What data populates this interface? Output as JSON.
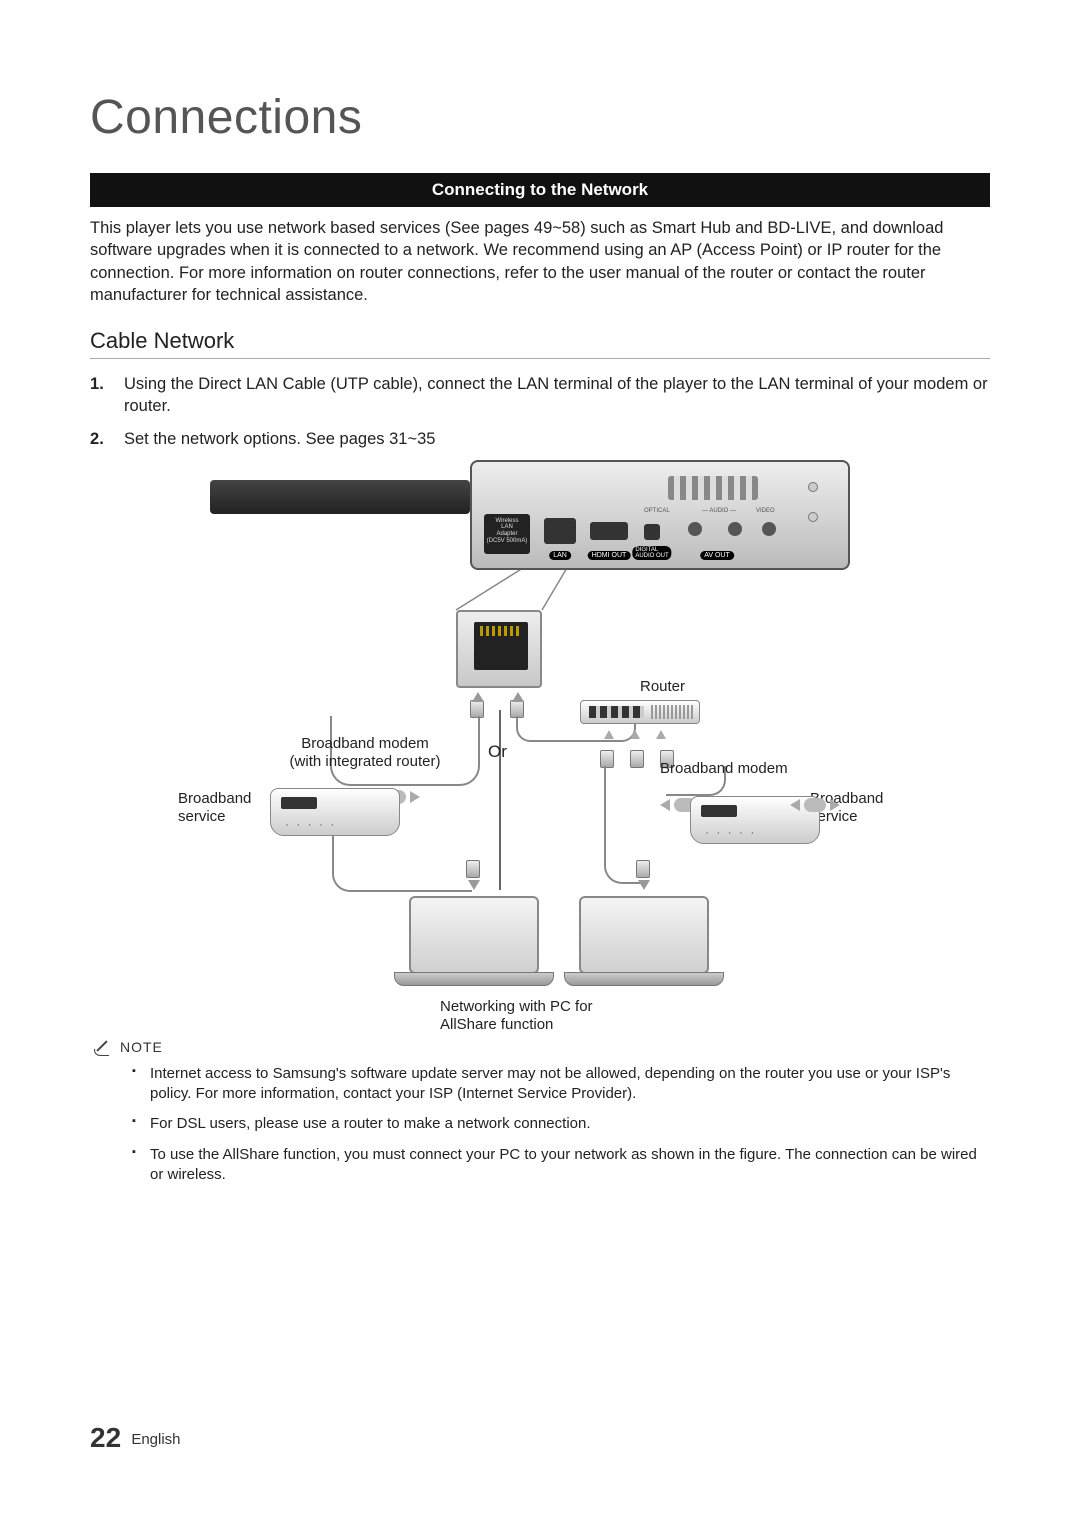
{
  "chapter_title": "Connections",
  "section_bar": "Connecting to the Network",
  "intro": "This player lets you use network based services (See pages 49~58) such as Smart Hub and BD-LIVE, and download software upgrades when it is connected to a network. We recommend using an AP (Access Point) or IP router for the connection. For more information on router connections, refer to the user manual of the router or contact the router manufacturer for technical assistance.",
  "sub_heading": "Cable Network",
  "steps": [
    "Using the Direct LAN Cable (UTP cable), connect the LAN terminal of the player to the LAN terminal of your modem or router.",
    "Set the network options. See pages 31~35"
  ],
  "diagram": {
    "ports": {
      "wlan": "Wireless\nLAN\nAdapter\n(DC5V 500mA)",
      "lan": "LAN",
      "hdmi": "HDMI OUT",
      "digital": "DIGITAL\nAUDIO OUT",
      "optical": "OPTICAL",
      "avout": "AV OUT",
      "audio": "— AUDIO —",
      "video": "VIDEO"
    },
    "router": "Router",
    "bb_modem_int": "Broadband modem\n(with integrated router)",
    "bb_modem": "Broadband modem",
    "bb_service_l": "Broadband\nservice",
    "bb_service_r": "Broadband\nservice",
    "or": "Or",
    "allshare": "Networking with PC for\nAllShare function"
  },
  "note_label": "NOTE",
  "notes": [
    "Internet access to Samsung's software update server may not be allowed, depending on the router you use or your ISP's policy. For more information, contact your ISP (Internet Service Provider).",
    "For DSL users, please use a router to make a network connection.",
    "To use the AllShare function, you must connect your PC to your network as shown in the figure. The connection can be wired or wireless."
  ],
  "footer": {
    "page": "22",
    "lang": "English"
  }
}
